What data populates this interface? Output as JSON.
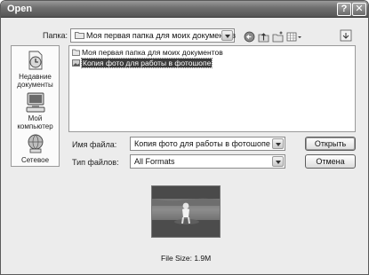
{
  "window": {
    "title": "Open",
    "help_glyph": "?",
    "close_glyph": "✕"
  },
  "toolbar": {
    "lookin_label": "Папка:",
    "lookin_value": "Моя первая папка для моих документов"
  },
  "places": [
    {
      "label_line1": "Недавние",
      "label_line2": "документы",
      "icon": "recent-documents-icon"
    },
    {
      "label_line1": "Мой",
      "label_line2": "компьютер",
      "icon": "my-computer-icon"
    },
    {
      "label_line1": "Сетевое",
      "label_line2": "",
      "icon": "network-icon"
    }
  ],
  "files": [
    {
      "name": "Моя первая папка для моих документов",
      "type": "folder",
      "selected": false
    },
    {
      "name": "Копия фото для работы в фотошопе",
      "type": "image",
      "selected": true
    }
  ],
  "form": {
    "filename_label": "Имя файла:",
    "filename_value": "Копия фото для работы в фотошопе",
    "filetype_label": "Тип файлов:",
    "filetype_value": "All Formats"
  },
  "buttons": {
    "open": "Открыть",
    "cancel": "Отмена"
  },
  "preview": {
    "file_size": "File Size: 1.9M"
  }
}
